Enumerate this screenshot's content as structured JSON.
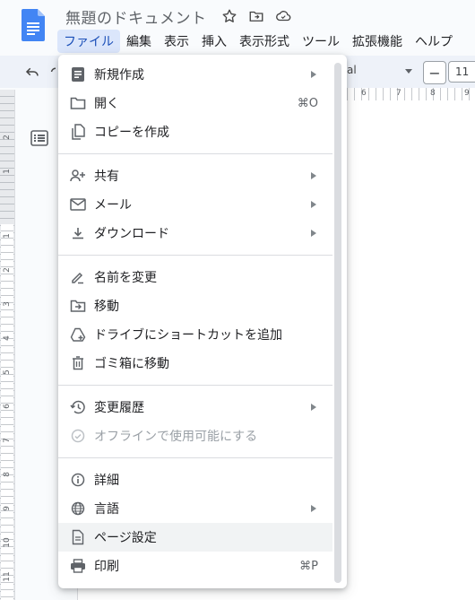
{
  "document": {
    "title": "無題のドキュメント"
  },
  "menubar": [
    "ファイル",
    "編集",
    "表示",
    "挿入",
    "表示形式",
    "ツール",
    "拡張機能",
    "ヘルプ"
  ],
  "toolbar": {
    "font_name": "al",
    "font_size": "11",
    "minus_label": "−"
  },
  "ruler": {
    "horizontal_labels": [
      "6",
      "7",
      "8",
      "9"
    ],
    "vertical_labels": [
      "2",
      "1",
      "1",
      "2",
      "3",
      "4",
      "5",
      "6",
      "7",
      "8",
      "9",
      "10",
      "11"
    ]
  },
  "file_menu": {
    "items": [
      {
        "label": "新規作成",
        "icon": "document-icon",
        "submenu": true
      },
      {
        "label": "開く",
        "icon": "folder-icon",
        "shortcut": "⌘O"
      },
      {
        "label": "コピーを作成",
        "icon": "copy-icon"
      },
      {
        "label": "共有",
        "icon": "person-add-icon",
        "submenu": true
      },
      {
        "label": "メール",
        "icon": "mail-icon",
        "submenu": true
      },
      {
        "label": "ダウンロード",
        "icon": "download-icon",
        "submenu": true
      },
      {
        "label": "名前を変更",
        "icon": "rename-icon"
      },
      {
        "label": "移動",
        "icon": "move-to-folder-icon"
      },
      {
        "label": "ドライブにショートカットを追加",
        "icon": "drive-shortcut-icon"
      },
      {
        "label": "ゴミ箱に移動",
        "icon": "trash-icon"
      },
      {
        "label": "変更履歴",
        "icon": "history-icon",
        "submenu": true
      },
      {
        "label": "オフラインで使用可能にする",
        "icon": "offline-icon",
        "disabled": true
      },
      {
        "label": "詳細",
        "icon": "info-icon"
      },
      {
        "label": "言語",
        "icon": "globe-icon",
        "submenu": true
      },
      {
        "label": "ページ設定",
        "icon": "page-setup-icon",
        "highlighted": true
      },
      {
        "label": "印刷",
        "icon": "print-icon",
        "shortcut": "⌘P"
      }
    ]
  },
  "colors": {
    "accent": "#1a73e8",
    "menu_active_bg": "#dbe6fb",
    "hover_bg": "#f1f3f4"
  }
}
